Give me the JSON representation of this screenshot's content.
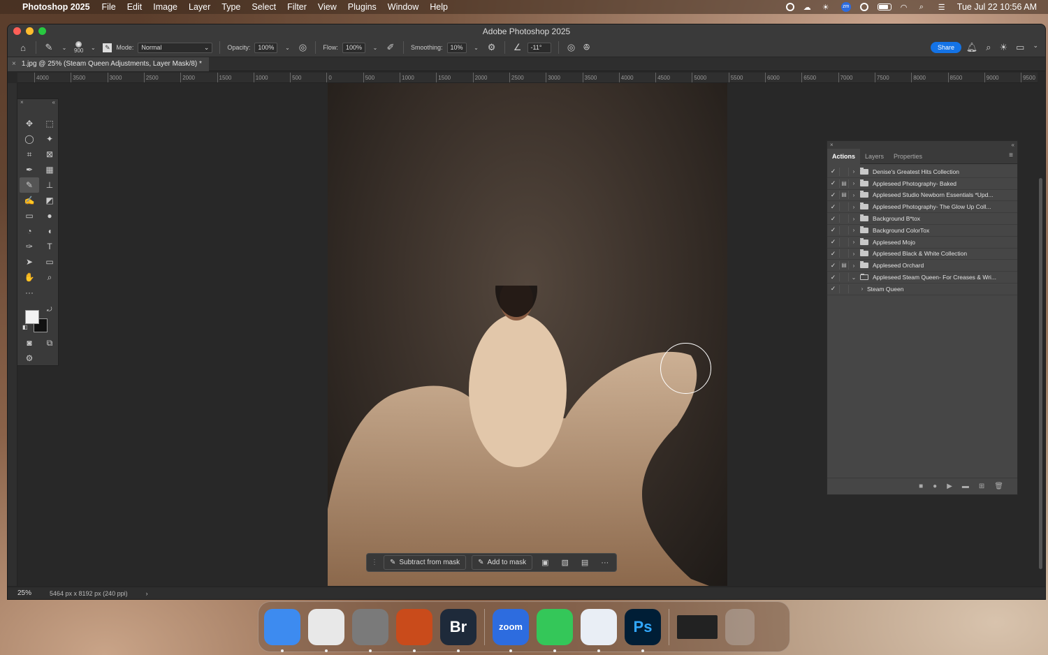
{
  "menubar": {
    "app_name": "Photoshop 2025",
    "items": [
      "File",
      "Edit",
      "Image",
      "Layer",
      "Type",
      "Select",
      "Filter",
      "View",
      "Plugins",
      "Window",
      "Help"
    ],
    "clock": "Tue Jul 22  10:56 AM",
    "zoom_badge": "zm"
  },
  "window": {
    "title": "Adobe Photoshop 2025"
  },
  "options": {
    "brush_size": "900",
    "mode_label": "Mode:",
    "mode_value": "Normal",
    "opacity_label": "Opacity:",
    "opacity_value": "100%",
    "flow_label": "Flow:",
    "flow_value": "100%",
    "smoothing_label": "Smoothing:",
    "smoothing_value": "10%",
    "angle_value": "-11°",
    "share_label": "Share"
  },
  "document": {
    "tab_title": "1.jpg @ 25% (Steam Queen Adjustments, Layer Mask/8) *",
    "zoom": "25%",
    "dimensions": "5464 px x 8192 px (240 ppi)"
  },
  "ruler_labels": [
    "4000",
    "3500",
    "3000",
    "2500",
    "2000",
    "1500",
    "1000",
    "500",
    "0",
    "500",
    "1000",
    "1500",
    "2000",
    "2500",
    "3000",
    "3500",
    "4000",
    "4500",
    "5000",
    "5500",
    "6000",
    "6500",
    "7000",
    "7500",
    "8000",
    "8500",
    "9000",
    "9500"
  ],
  "taskbar": {
    "subtract_label": "Subtract from mask",
    "add_label": "Add to mask"
  },
  "panel": {
    "tabs": [
      "Actions",
      "Layers",
      "Properties"
    ],
    "active_tab": "Actions",
    "actions": [
      {
        "label": "Denise's Greatest Hits Collection",
        "dialog": false,
        "expanded": false,
        "level": 0
      },
      {
        "label": "Appleseed Photography- Baked",
        "dialog": true,
        "expanded": false,
        "level": 0
      },
      {
        "label": "Appleseed Studio Newborn Essentials *Upd...",
        "dialog": true,
        "expanded": false,
        "level": 0
      },
      {
        "label": "Appleseed Photography-  The Glow Up Coll...",
        "dialog": false,
        "expanded": false,
        "level": 0
      },
      {
        "label": "Background B*tox",
        "dialog": false,
        "expanded": false,
        "level": 0
      },
      {
        "label": "Background ColorTox",
        "dialog": false,
        "expanded": false,
        "level": 0
      },
      {
        "label": "Appleseed Mojo",
        "dialog": false,
        "expanded": false,
        "level": 0
      },
      {
        "label": "Appleseed Black & White Collection",
        "dialog": false,
        "expanded": false,
        "level": 0
      },
      {
        "label": "Appleseed Orchard",
        "dialog": true,
        "expanded": false,
        "level": 0
      },
      {
        "label": "Appleseed Steam Queen- For Creases & Wri...",
        "dialog": false,
        "expanded": true,
        "level": 0
      },
      {
        "label": "Steam Queen",
        "dialog": false,
        "expanded": false,
        "level": 1
      }
    ]
  },
  "dock": {
    "apps": [
      {
        "name": "finder",
        "label": "",
        "color": "#3d8bf0"
      },
      {
        "name": "chrome",
        "label": "",
        "color": "#e8e8e8"
      },
      {
        "name": "system-settings",
        "label": "",
        "color": "#7a7a7a"
      },
      {
        "name": "app-orange",
        "label": "",
        "color": "#c94b1b"
      },
      {
        "name": "bridge",
        "label": "Br",
        "color": "#1e2a3a"
      },
      {
        "name": "zoom",
        "label": "zoom",
        "color": "#2d6cdf"
      },
      {
        "name": "messages",
        "label": "",
        "color": "#34c759"
      },
      {
        "name": "safari",
        "label": "",
        "color": "#e9eef5"
      },
      {
        "name": "photoshop",
        "label": "Ps",
        "color": "#001e36"
      }
    ]
  }
}
